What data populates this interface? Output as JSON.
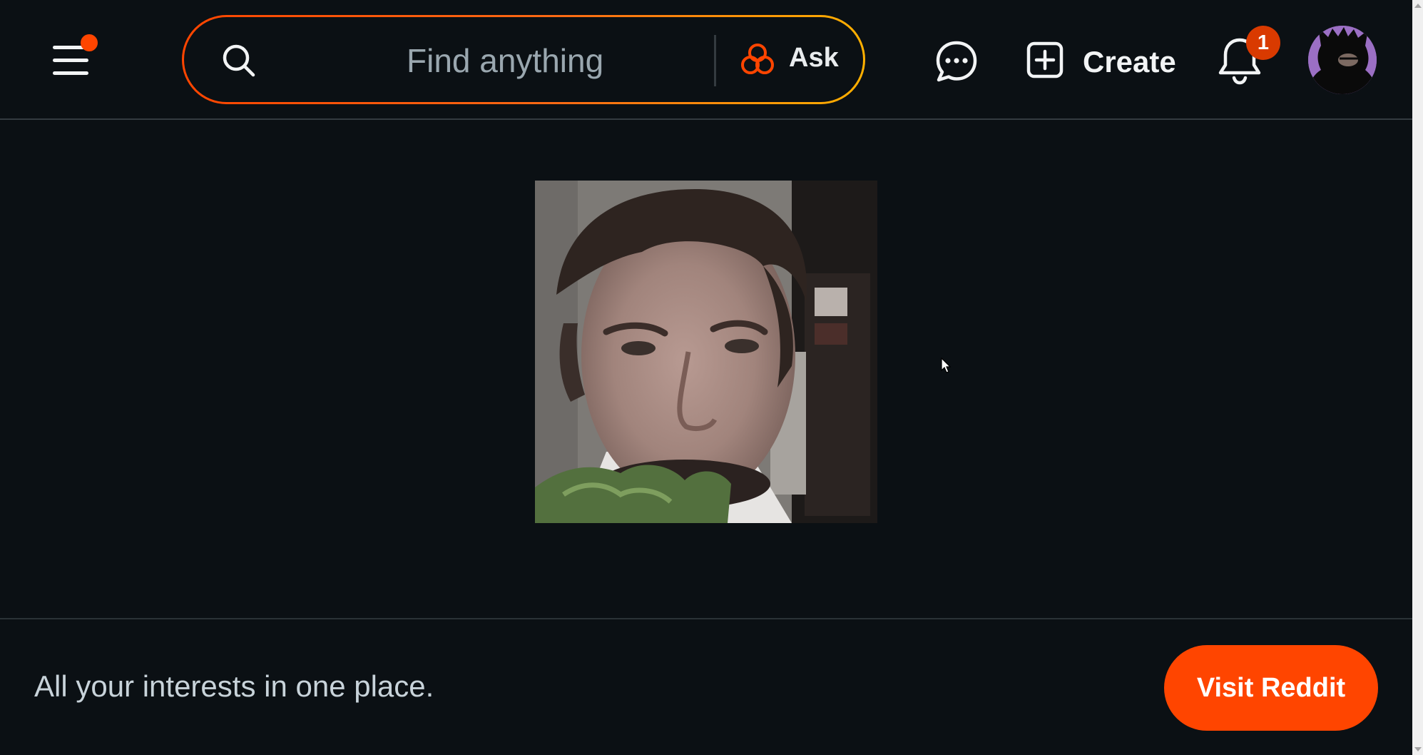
{
  "header": {
    "search": {
      "placeholder": "Find anything",
      "ask_label": "Ask"
    },
    "create_label": "Create",
    "notification_count": "1",
    "icons": {
      "menu": "hamburger-menu-icon",
      "search": "search-icon",
      "ask": "reddit-answers-icon",
      "chat": "chat-icon",
      "create": "plus-square-icon",
      "notifications": "bell-icon",
      "avatar": "user-avatar"
    }
  },
  "footer": {
    "tagline": "All your interests in one place.",
    "cta_label": "Visit Reddit"
  },
  "colors": {
    "background": "#0b1014",
    "accent": "#ff4500",
    "badge": "#d93a00",
    "search_gradient": [
      "#ff4500",
      "#ffb000"
    ]
  }
}
